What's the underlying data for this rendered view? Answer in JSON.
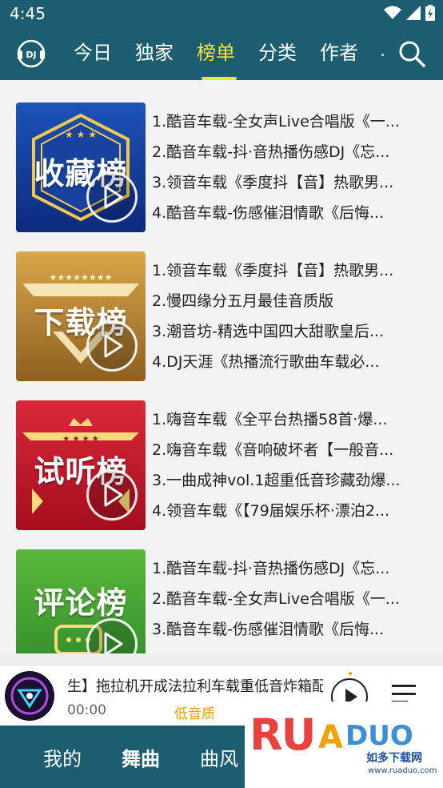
{
  "status_bar": {
    "time": "4:45"
  },
  "top_nav": {
    "tabs": [
      "今日",
      "独家",
      "榜单",
      "分类",
      "作者"
    ],
    "active_tab_index": 2
  },
  "rankings": [
    {
      "cover_title": "收藏榜",
      "cover_colors": [
        "#0d2a7e",
        "#1d53b8"
      ],
      "songs": [
        "1.酷音车载-全女声Live合唱版《一...",
        "2.酷音车载-抖·音热播伤感DJ《忘...",
        "3.领音车载《季度抖【音】热歌男...",
        "4.酷音车载-伤感催泪情歌《后悔..."
      ]
    },
    {
      "cover_title": "下载榜",
      "cover_colors": [
        "#8e6020",
        "#d9a64a"
      ],
      "songs": [
        "1.领音车载《季度抖【音】热歌男...",
        "2.慢四缘分五月最佳音质版",
        "3.潮音坊-精选中国四大甜歌皇后...",
        "4.DJ天涯《热播流行歌曲车载必..."
      ]
    },
    {
      "cover_title": "试听榜",
      "cover_colors": [
        "#a50e1e",
        "#d9283a"
      ],
      "songs": [
        "1.嗨音车载《全平台热播58首·爆...",
        "2.嗨音车载《音响破坏者【一般音...",
        "3.一曲成神vol.1超重低音珍藏劲爆...",
        "4.领音车载《【79届娱乐杯·漂泊2..."
      ]
    },
    {
      "cover_title": "评论榜",
      "cover_colors": [
        "#2f8a2a",
        "#5ab83a"
      ],
      "songs": [
        "1.酷音车载-抖·音热播伤感DJ《忘...",
        "2.酷音车载-全女声Live合唱版《一...",
        "3.酷音车载-伤感催泪情歌《后悔..."
      ]
    }
  ],
  "player": {
    "title": "生】拖拉机开成法拉利车载重低音炸箱配",
    "time": "00:00",
    "quality": "低音质"
  },
  "bottom_nav": {
    "items": [
      "我的",
      "舞曲",
      "曲风"
    ],
    "active_index": 1
  },
  "watermark": {
    "brand_left": "RU",
    "brand_right": "DUO",
    "cn": "如多下载网",
    "url": "www.ruaduo.com"
  },
  "colors": {
    "header": "#1c5e6f",
    "accent": "#f6e33a",
    "quality": "#e8a000"
  }
}
